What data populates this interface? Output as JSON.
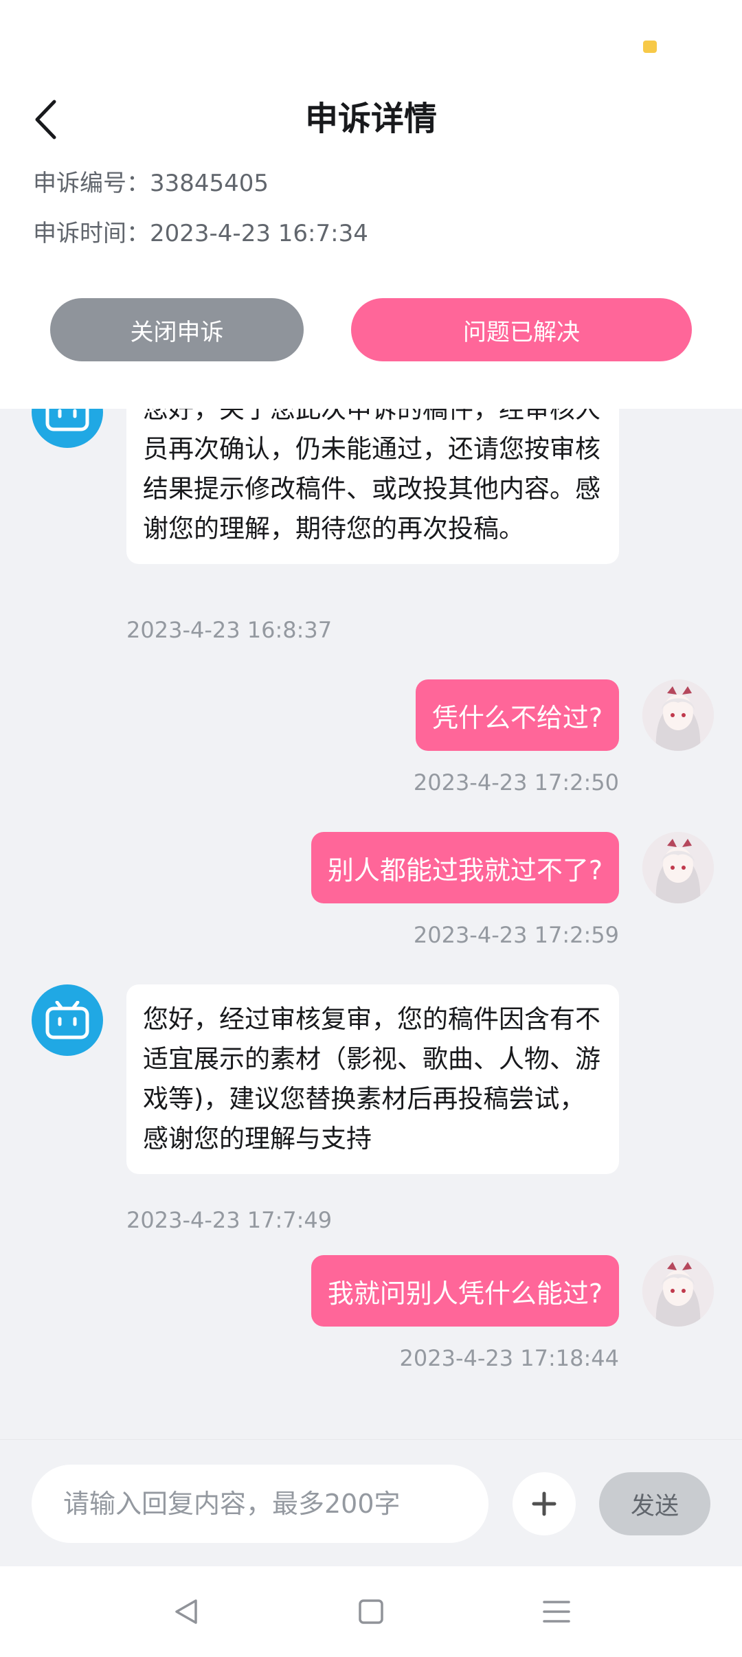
{
  "header": {
    "title": "申诉详情",
    "appeal_no_label": "申诉编号：",
    "appeal_no": "33845405",
    "appeal_time_label": "申诉时间：",
    "appeal_time": "2023-4-23 16:7:34",
    "close_button": "关闭申诉",
    "solved_button": "问题已解决"
  },
  "messages": [
    {
      "from": "bot",
      "text": "您好，关于您此次申诉的稿件，经审核人员再次确认，仍未能通过，还请您按审核结果提示修改稿件、或改投其他内容。感谢您的理解，期待您的再次投稿。",
      "time": "2023-4-23 16:8:37"
    },
    {
      "from": "user",
      "text": "凭什么不给过?",
      "time": "2023-4-23 17:2:50"
    },
    {
      "from": "user",
      "text": "别人都能过我就过不了?",
      "time": "2023-4-23 17:2:59"
    },
    {
      "from": "bot",
      "text": "您好，经过审核复审，您的稿件因含有不适宜展示的素材（影视、歌曲、人物、游戏等)，建议您替换素材后再投稿尝试，感谢您的理解与支持",
      "time": "2023-4-23 17:7:49"
    },
    {
      "from": "user",
      "text": "我就问别人凭什么能过?",
      "time": "2023-4-23 17:18:44"
    }
  ],
  "input": {
    "placeholder": "请输入回复内容，最多200字",
    "value": "",
    "send_label": "发送"
  },
  "colors": {
    "accent_pink": "#ff6699",
    "bot_blue": "#20a8e4",
    "close_gray": "#8f949b"
  },
  "icons": {
    "back": "chevron-left-icon",
    "bot": "bilibili-tv-icon",
    "plus": "plus-icon",
    "nav_back": "triangle-back-icon",
    "nav_home": "square-home-icon",
    "nav_menu": "menu-lines-icon"
  }
}
